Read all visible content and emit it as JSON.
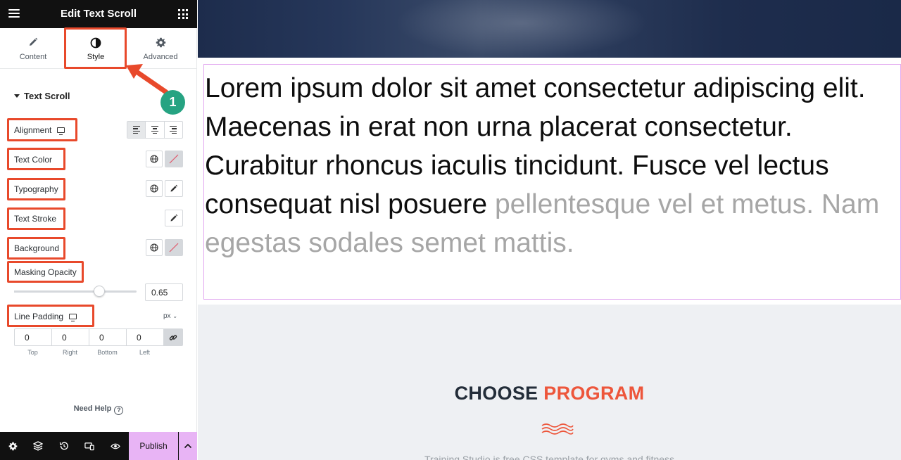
{
  "panel": {
    "title": "Edit Text Scroll",
    "tabs": [
      {
        "label": "Content",
        "icon": "pencil-icon"
      },
      {
        "label": "Style",
        "icon": "contrast-icon"
      },
      {
        "label": "Advanced",
        "icon": "gear-icon"
      }
    ],
    "section_title": "Text Scroll",
    "controls": {
      "alignment": "Alignment",
      "text_color": "Text Color",
      "typography": "Typography",
      "text_stroke": "Text Stroke",
      "background": "Background",
      "masking_opacity": "Masking Opacity",
      "masking_opacity_value": "0.65",
      "line_padding": "Line Padding",
      "unit": "px"
    },
    "padding": {
      "values": [
        "0",
        "0",
        "0",
        "0"
      ],
      "labels": [
        "Top",
        "Right",
        "Bottom",
        "Left"
      ]
    },
    "need_help": "Need Help",
    "publish": "Publish",
    "annotation_number": "1"
  },
  "canvas": {
    "text_dark": "Lorem ipsum dolor sit amet consectetur adipiscing elit. Maecenas in erat non urna placerat consectetur. Curabitur rhoncus iaculis tincidunt. Fusce vel lectus consequat nisl posuere",
    "text_faded": "pellentesque vel et metus. Nam egestas sodales semet mattis.",
    "heading_part1": "CHOOSE",
    "heading_part2": "PROGRAM",
    "subtitle": "Training Studio is free CSS template for gyms and fitness"
  },
  "colors": {
    "highlight": "#e8492b",
    "badge": "#26a382",
    "publish_bg": "#e8b4f5",
    "accent_orange": "#ed563b",
    "heading_dark": "#232d39"
  }
}
